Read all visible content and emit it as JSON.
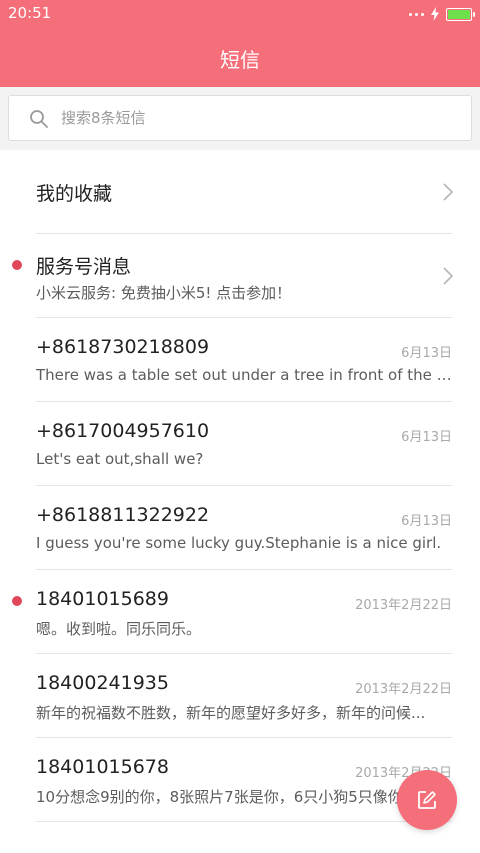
{
  "status_bar": {
    "time": "20:51"
  },
  "header": {
    "title": "短信"
  },
  "search": {
    "placeholder": "搜索8条短信"
  },
  "favorites": {
    "label": "我的收藏"
  },
  "conversations": [
    {
      "title": "服务号消息",
      "snippet": "小米云服务: 免费抽小米5! 点击参加！",
      "date": "",
      "unread": true,
      "chevron": true
    },
    {
      "title": "+8618730218809",
      "snippet": "There was a table set out under a tree in front of the ho...",
      "date": "6月13日",
      "unread": false,
      "chevron": false
    },
    {
      "title": "+8617004957610",
      "snippet": "Let's eat out,shall we?",
      "date": "6月13日",
      "unread": false,
      "chevron": false
    },
    {
      "title": "+8618811322922",
      "snippet": "I guess you're some lucky guy.Stephanie is a nice girl.",
      "date": "6月13日",
      "unread": false,
      "chevron": false
    },
    {
      "title": "18401015689",
      "snippet": "嗯。收到啦。同乐同乐。",
      "date": "2013年2月22日",
      "unread": true,
      "chevron": false
    },
    {
      "title": "18400241935",
      "snippet": "新年的祝福数不胜数，新年的愿望好多好多，新年的问候...",
      "date": "2013年2月22日",
      "unread": false,
      "chevron": false
    },
    {
      "title": "18401015678",
      "snippet": "10分想念9别的你，8张照片7张是你，6只小狗5只像你",
      "date": "2013年2月22日",
      "unread": false,
      "chevron": false
    }
  ],
  "colors": {
    "accent": "#f46f7a",
    "unread_dot": "#e0485a",
    "battery": "#6ee04d"
  },
  "icons": {
    "search": "search-icon",
    "compose": "compose-icon",
    "chevron": "chevron-right-icon"
  }
}
